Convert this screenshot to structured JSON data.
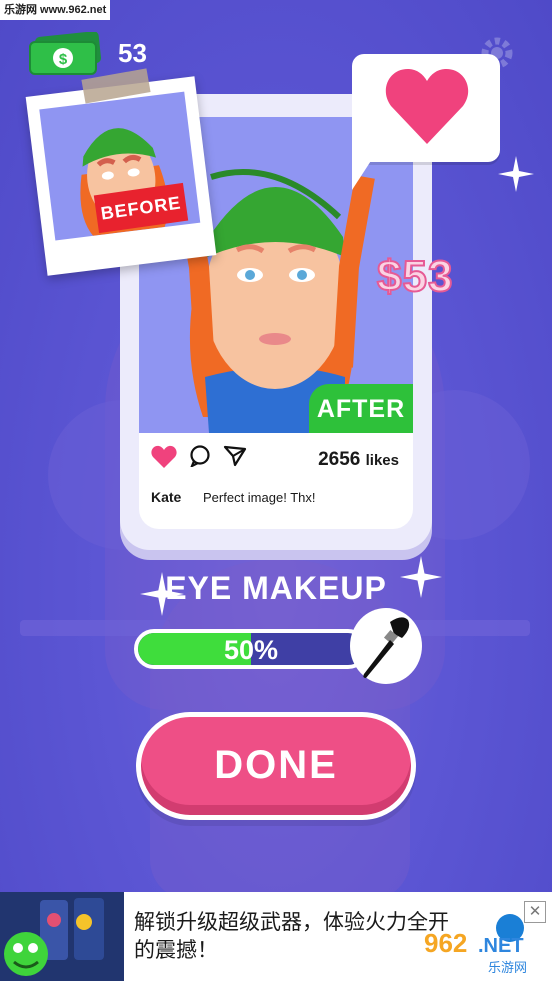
{
  "watermark": {
    "text": "乐游网 www.962.net"
  },
  "hud": {
    "cash_count": "53",
    "cash_icon": "cash-stack-icon",
    "settings_icon": "gear-icon"
  },
  "post": {
    "after_label": "AFTER",
    "before_label": "BEFORE",
    "likes_count": "2656",
    "likes_label": "likes",
    "username": "Kate",
    "comment": "Perfect image! Thx!",
    "price": "$53"
  },
  "task": {
    "title": "EYE MAKEUP",
    "progress_text": "50%",
    "progress_value": 0.5
  },
  "actions": {
    "done_label": "DONE"
  },
  "ad": {
    "text": "解锁升级超级武器，体验火力全开的震撼！",
    "logo_text": "962.NET",
    "logo_sub": "乐游网"
  },
  "colors": {
    "background": "#5a55d3",
    "done_button": "#ee4f86",
    "after_badge": "#2ec13a",
    "before_badge": "#e8222e",
    "progress_fill": "#3fdd3c",
    "heart": "#f0427d"
  }
}
